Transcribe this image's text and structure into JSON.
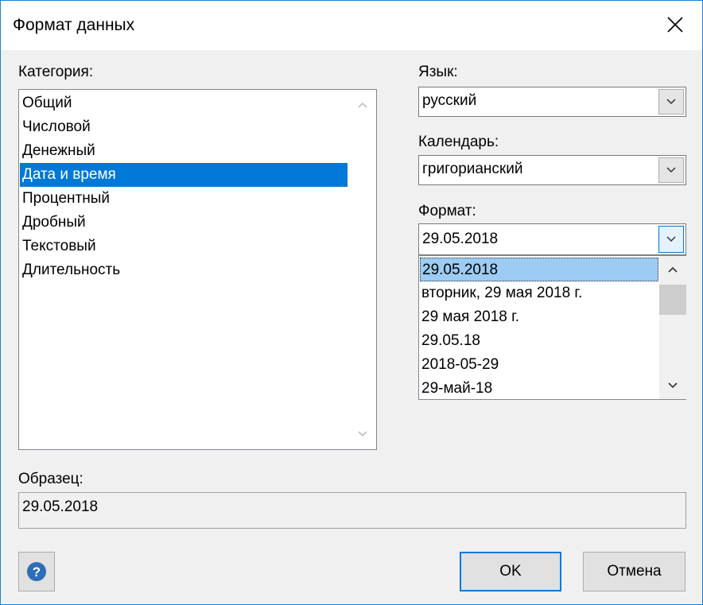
{
  "dialog": {
    "title": "Формат данных",
    "close_icon": "close-icon"
  },
  "category": {
    "label": "Категория:",
    "items": [
      "Общий",
      "Числовой",
      "Денежный",
      "Дата и время",
      "Процентный",
      "Дробный",
      "Текстовый",
      "Длительность"
    ],
    "selected": "Дата и время"
  },
  "language": {
    "label": "Язык:",
    "value": "русский"
  },
  "calendar": {
    "label": "Календарь:",
    "value": "григорианский"
  },
  "format": {
    "label": "Формат:",
    "value": "29.05.2018",
    "options": [
      "29.05.2018",
      "вторник, 29 мая 2018 г.",
      "29 мая 2018 г.",
      "29.05.18",
      "2018-05-29",
      "29-май-18"
    ],
    "selected": "29.05.2018"
  },
  "sample": {
    "label": "Образец:",
    "value": "29.05.2018"
  },
  "buttons": {
    "help_icon": "help-icon",
    "ok": "OK",
    "cancel": "Отмена"
  },
  "colors": {
    "accent": "#0078d7",
    "selection_light": "#9ccbf3",
    "window_border": "#1883d7"
  }
}
